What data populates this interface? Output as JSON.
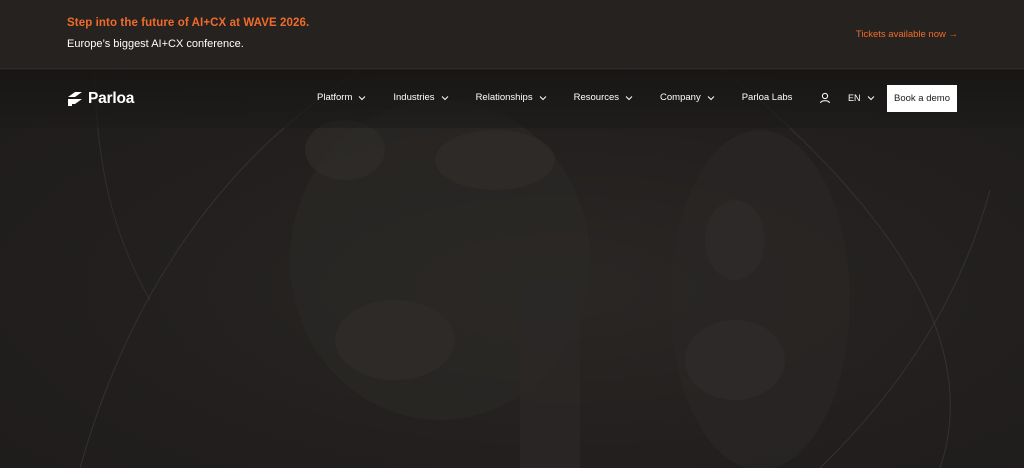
{
  "banner": {
    "headline": "Step into the future of AI+CX at WAVE 2026.",
    "subline": "Europe’s biggest AI+CX conference.",
    "cta_label": "Tickets available now →"
  },
  "header": {
    "logo_text": "Parloa",
    "nav_items": [
      {
        "label": "Platform",
        "icon": "chevron-down-icon"
      },
      {
        "label": "Industries",
        "icon": "chevron-down-icon"
      },
      {
        "label": "Relationships",
        "icon": "chevron-down-icon"
      },
      {
        "label": "Resources",
        "icon": "chevron-down-icon"
      },
      {
        "label": "Company",
        "icon": "chevron-down-icon"
      },
      {
        "label": "Parloa Labs"
      }
    ],
    "account_icon": "user-icon",
    "language": "EN",
    "demo_button": "Book a demo"
  },
  "colors": {
    "accent": "#f26b2a",
    "background": "#1f1d1c",
    "banner_background": "#252220",
    "button_background": "#ffffff"
  }
}
